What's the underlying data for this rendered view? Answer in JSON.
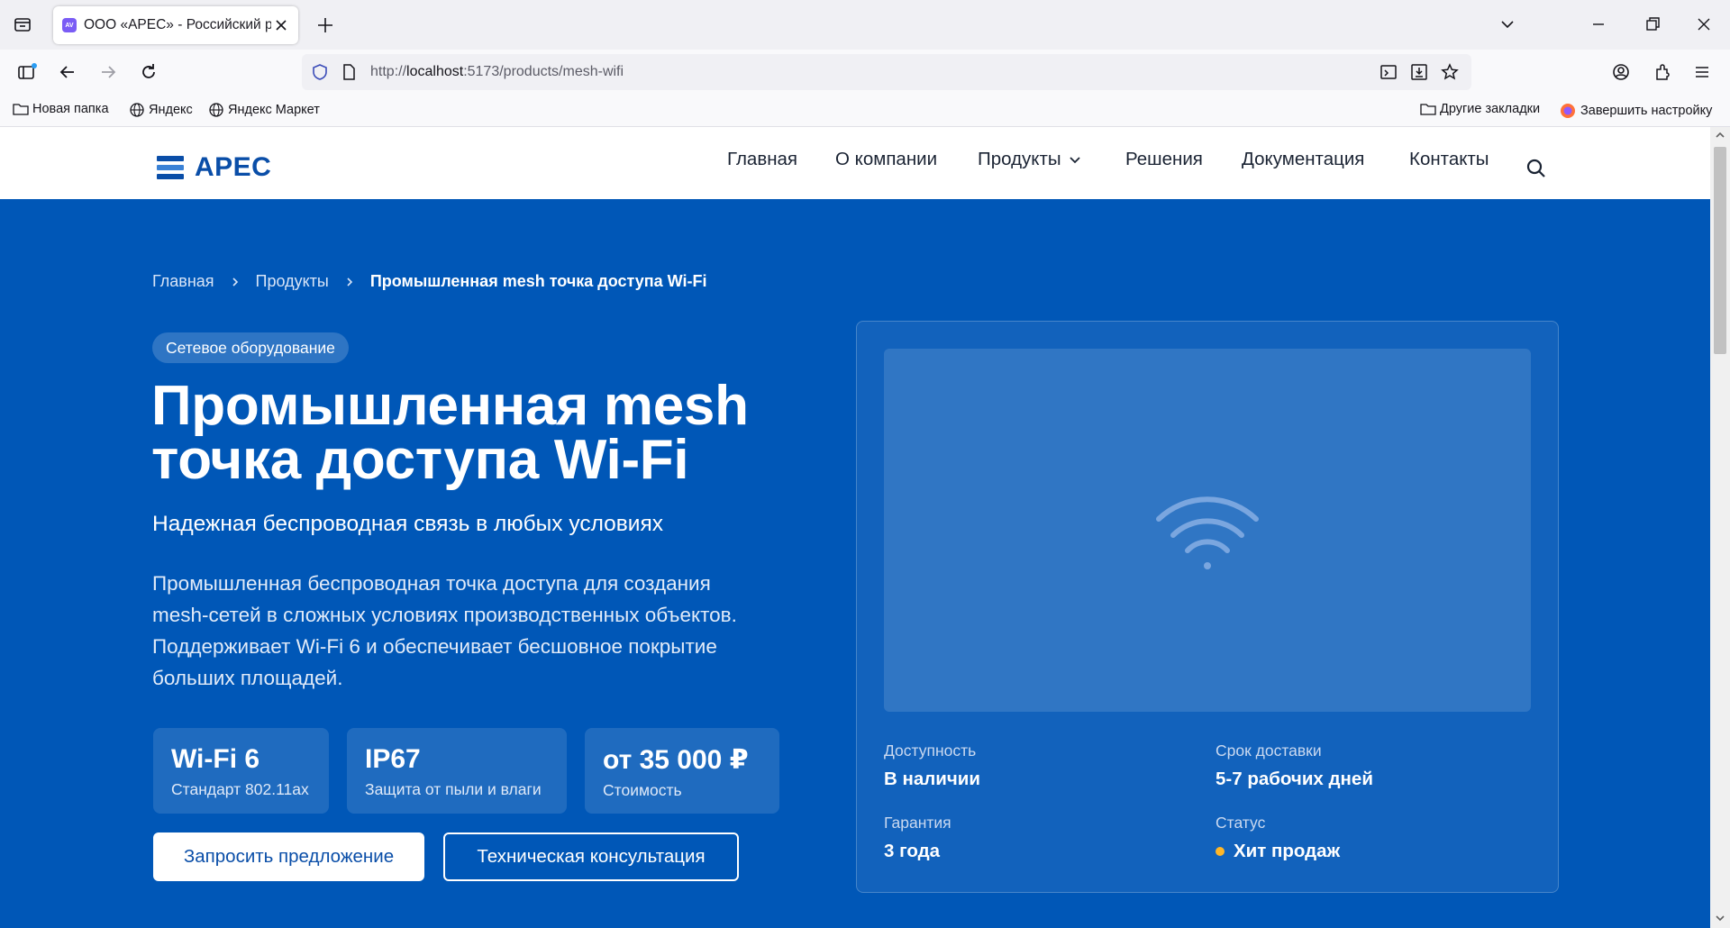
{
  "browser": {
    "tab_title": "ООО «АРЕС» - Российский разработчик",
    "favicon_text": "AV",
    "url_host": "localhost",
    "url_rest": ":5173/products/mesh-wifi",
    "url_scheme": "http://",
    "bookmarks": [
      "Новая папка",
      "Яндекс",
      "Яндекс Маркет"
    ],
    "bookmarks_right": [
      "Другие закладки",
      "Завершить настройку"
    ]
  },
  "site": {
    "logo_text": "АРЕС",
    "nav": [
      "Главная",
      "О компании",
      "Продукты",
      "Решения",
      "Документация",
      "Контакты"
    ]
  },
  "hero": {
    "breadcrumb": [
      "Главная",
      "Продукты",
      "Промышленная mesh точка доступа Wi-Fi"
    ],
    "category": "Сетевое оборудование",
    "title_lines": [
      "Промышленная mesh",
      "точка доступа Wi-Fi"
    ],
    "subtitle": "Надежная беспроводная связь в любых условиях",
    "description_lines": [
      "Промышленная беспроводная точка доступа для создания",
      "mesh-сетей в сложных условиях производственных объектов.",
      "Поддерживает Wi-Fi 6 и обеспечивает бесшовное покрытие",
      "больших площадей."
    ],
    "specs": [
      {
        "value": "Wi-Fi 6",
        "label": "Стандарт 802.11ax"
      },
      {
        "value": "IP67",
        "label": "Защита от пыли и влаги"
      },
      {
        "value": "от 35 000 ₽",
        "label": "Стоимость"
      }
    ],
    "btn_primary": "Запросить предложение",
    "btn_secondary": "Техническая консультация"
  },
  "product_info": {
    "availability_label": "Доступность",
    "availability_value": "В наличии",
    "delivery_label": "Срок доставки",
    "delivery_value": "5-7 рабочих дней",
    "warranty_label": "Гарантия",
    "warranty_value": "3 года",
    "status_label": "Статус",
    "status_value": "Хит продаж",
    "status_color": "#ffb627",
    "image_icon": "wifi-icon"
  }
}
